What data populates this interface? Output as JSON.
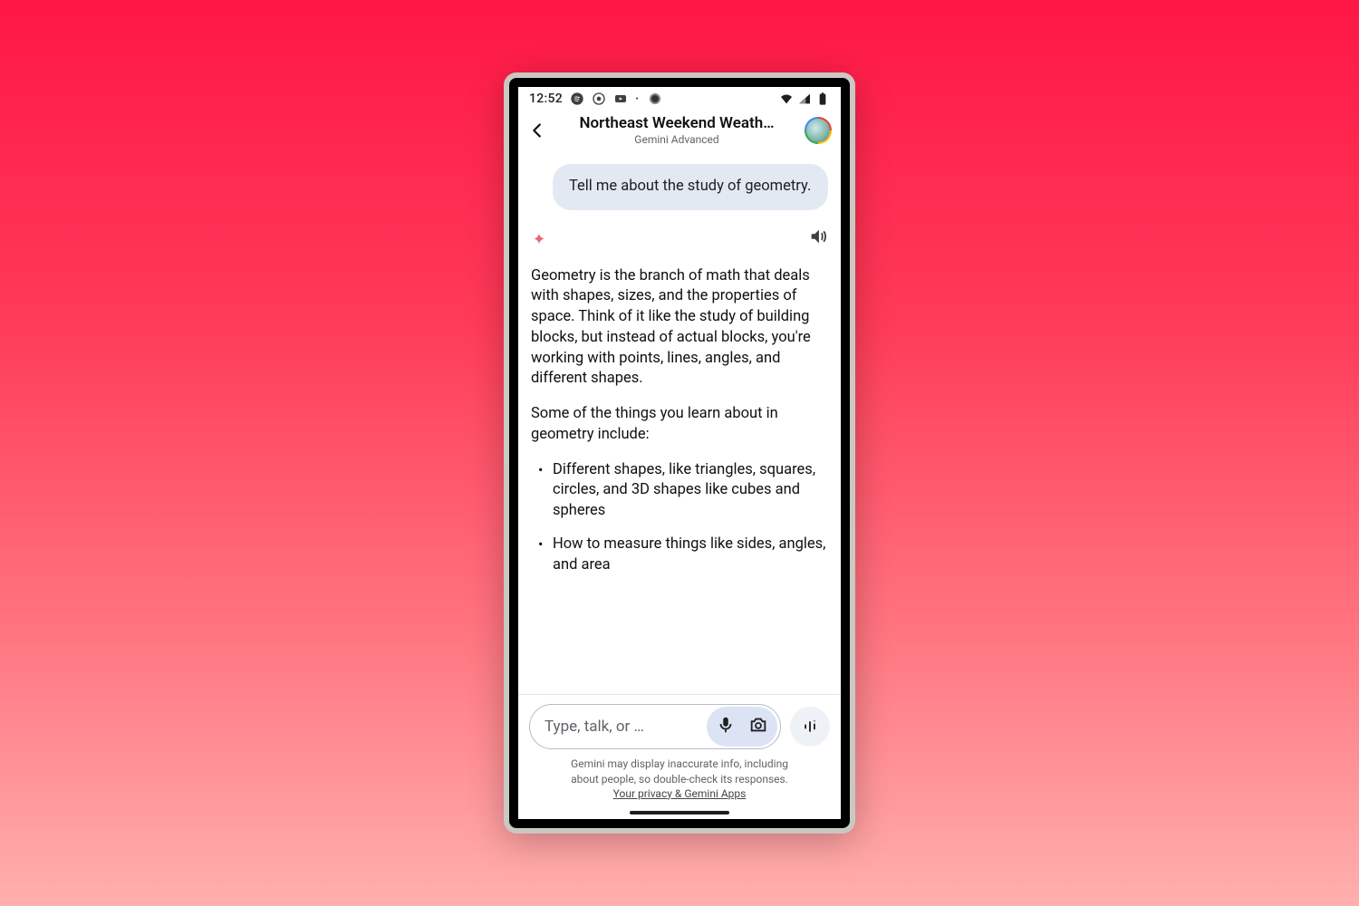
{
  "statusbar": {
    "time": "12:52"
  },
  "header": {
    "title": "Northeast Weekend Weath…",
    "subtitle": "Gemini Advanced"
  },
  "chat": {
    "user_message": "Tell me about the study of geometry.",
    "response": {
      "p1": "Geometry is the branch of math that deals with shapes, sizes, and the properties of space. Think of it like the study of building blocks, but instead of actual blocks, you're working with points, lines, angles, and different shapes.",
      "p2": "Some of the things you learn about in geometry include:",
      "li1": "Different shapes, like triangles, squares, circles, and 3D shapes like cubes and spheres",
      "li2": "How to measure things like sides, angles, and area"
    }
  },
  "input": {
    "placeholder": "Type, talk, or …"
  },
  "footer": {
    "disclaimer_l1": "Gemini may display inaccurate info, including",
    "disclaimer_l2": "about people, so double-check its responses.",
    "privacy": "Your privacy & Gemini Apps"
  }
}
